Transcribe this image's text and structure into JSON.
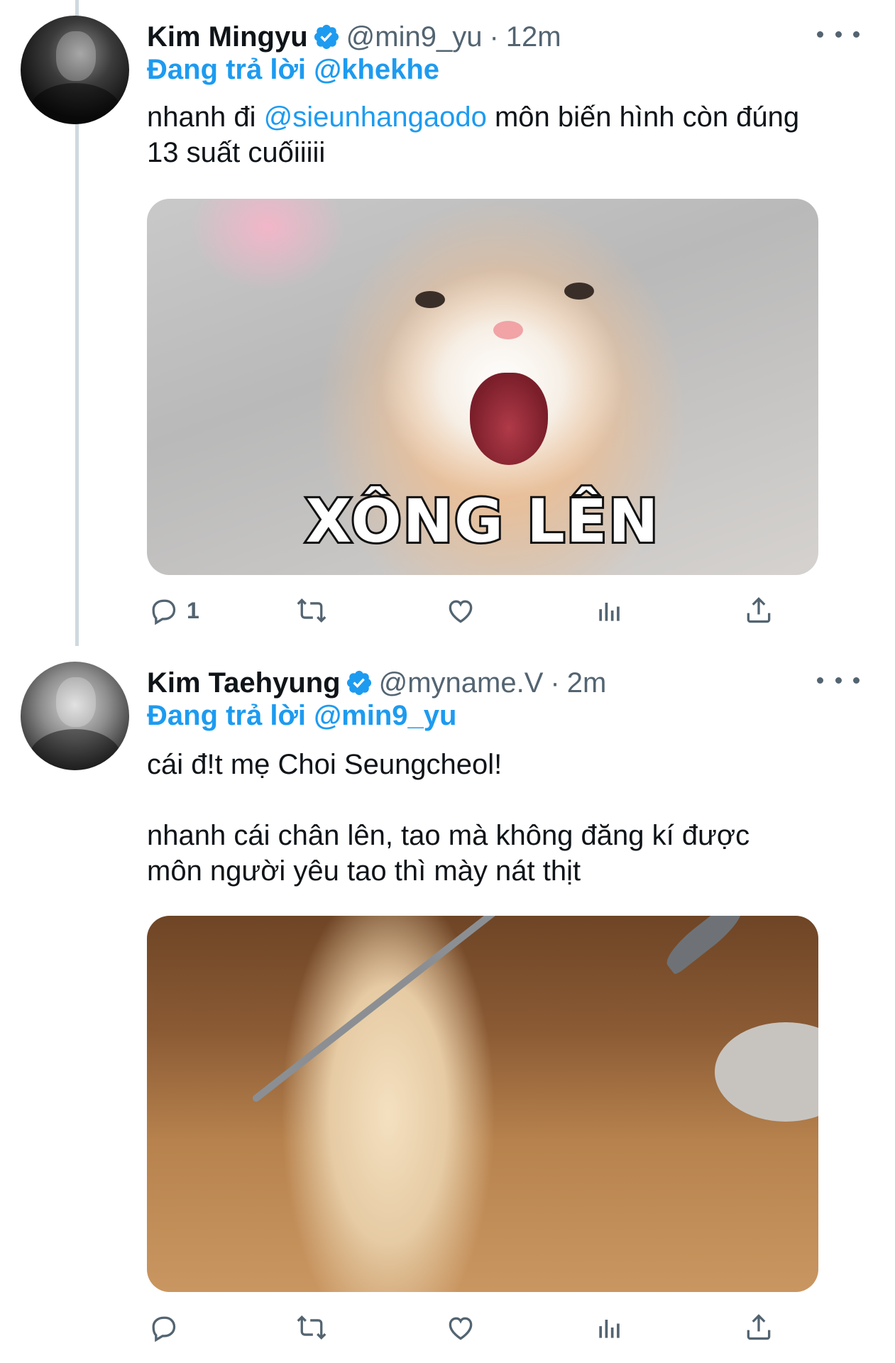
{
  "thread": {
    "tweets": [
      {
        "name": "Kim Mingyu",
        "handle": "@min9_yu",
        "time": "12m",
        "reply_prefix": "Đang trả lời",
        "reply_to": "@khekhe",
        "text_before": "nhanh đi",
        "mention": "@sieunhangaodo",
        "text_after": "môn biến hình còn đúng 13 suất cuốiiiii",
        "image_caption": "XÔNG LÊN",
        "reply_count": "1"
      },
      {
        "name": "Kim Taehyung",
        "handle": "@myname.V",
        "time": "2m",
        "reply_prefix": "Đang trả lời",
        "reply_to": "@min9_yu",
        "line1": "cái đ!t mẹ Choi Seungcheol!",
        "line2": "nhanh cái chân lên, tao mà không đăng kí được",
        "line3": "môn người yêu tao thì mày nát thịt",
        "reply_count": ""
      }
    ]
  },
  "colors": {
    "accent": "#1d9bf0",
    "muted": "#536471",
    "text": "#0f1419",
    "thread_line": "#cfd9de"
  },
  "icons": [
    "verified-badge-icon",
    "more-icon",
    "reply-icon",
    "retweet-icon",
    "like-icon",
    "views-icon",
    "share-icon"
  ]
}
